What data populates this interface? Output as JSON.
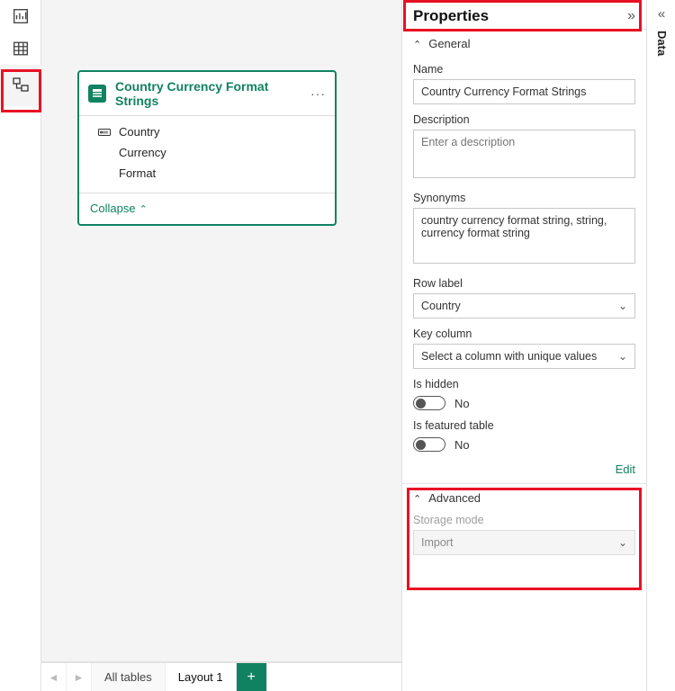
{
  "leftRail": {
    "reportTip": "Report view",
    "dataTip": "Data view",
    "modelTip": "Model view"
  },
  "tableCard": {
    "title": "Country Currency Format Strings",
    "fields": [
      "Country",
      "Currency",
      "Format"
    ],
    "collapseLabel": "Collapse"
  },
  "dataRail": {
    "label": "Data"
  },
  "properties": {
    "title": "Properties",
    "general": {
      "header": "General",
      "name": {
        "label": "Name",
        "value": "Country Currency Format Strings"
      },
      "description": {
        "label": "Description",
        "placeholder": "Enter a description",
        "value": ""
      },
      "synonyms": {
        "label": "Synonyms",
        "value": "country currency format string, string, currency format string"
      },
      "rowLabel": {
        "label": "Row label",
        "value": "Country"
      },
      "keyColumn": {
        "label": "Key column",
        "value": "Select a column with unique values"
      },
      "isHidden": {
        "label": "Is hidden",
        "stateLabel": "No"
      },
      "isFeatured": {
        "label": "Is featured table",
        "stateLabel": "No"
      },
      "editLink": "Edit"
    },
    "advanced": {
      "header": "Advanced",
      "storageMode": {
        "label": "Storage mode",
        "value": "Import"
      }
    }
  },
  "tabs": {
    "allTables": "All tables",
    "layout1": "Layout 1",
    "addTip": "New layout"
  }
}
